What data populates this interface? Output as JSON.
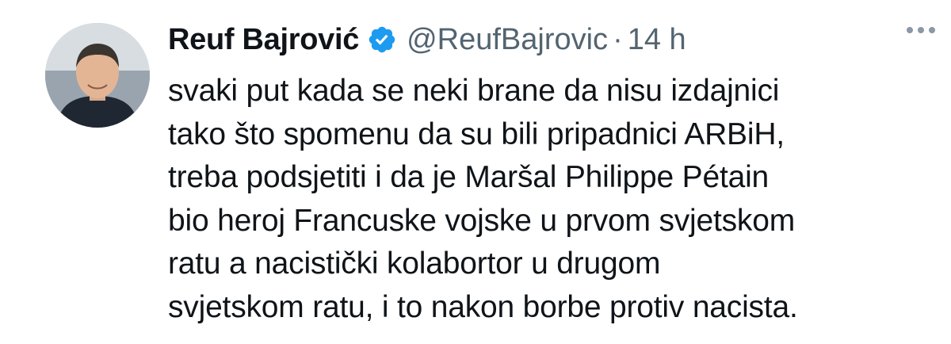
{
  "author": {
    "name": "Reuf Bajrović",
    "handle": "@ReufBajrovic",
    "separator": "·",
    "time": "14 h",
    "verified_icon": "verified-badge-icon",
    "badge_color": "#1d9bf0"
  },
  "tweet": {
    "lines": [
      "svaki put kada se neki brane da nisu izdajnici",
      "tako što spomenu da su bili pripadnici ARBiH,",
      "treba podsjetiti i da je Maršal Philippe Pétain",
      "bio heroj Francuske vojske u prvom svjetskom",
      "ratu a nacistički kolabortor u drugom",
      "svjetskom ratu, i to nakon borbe protiv nacista."
    ]
  },
  "more_icon": "more-options-icon"
}
